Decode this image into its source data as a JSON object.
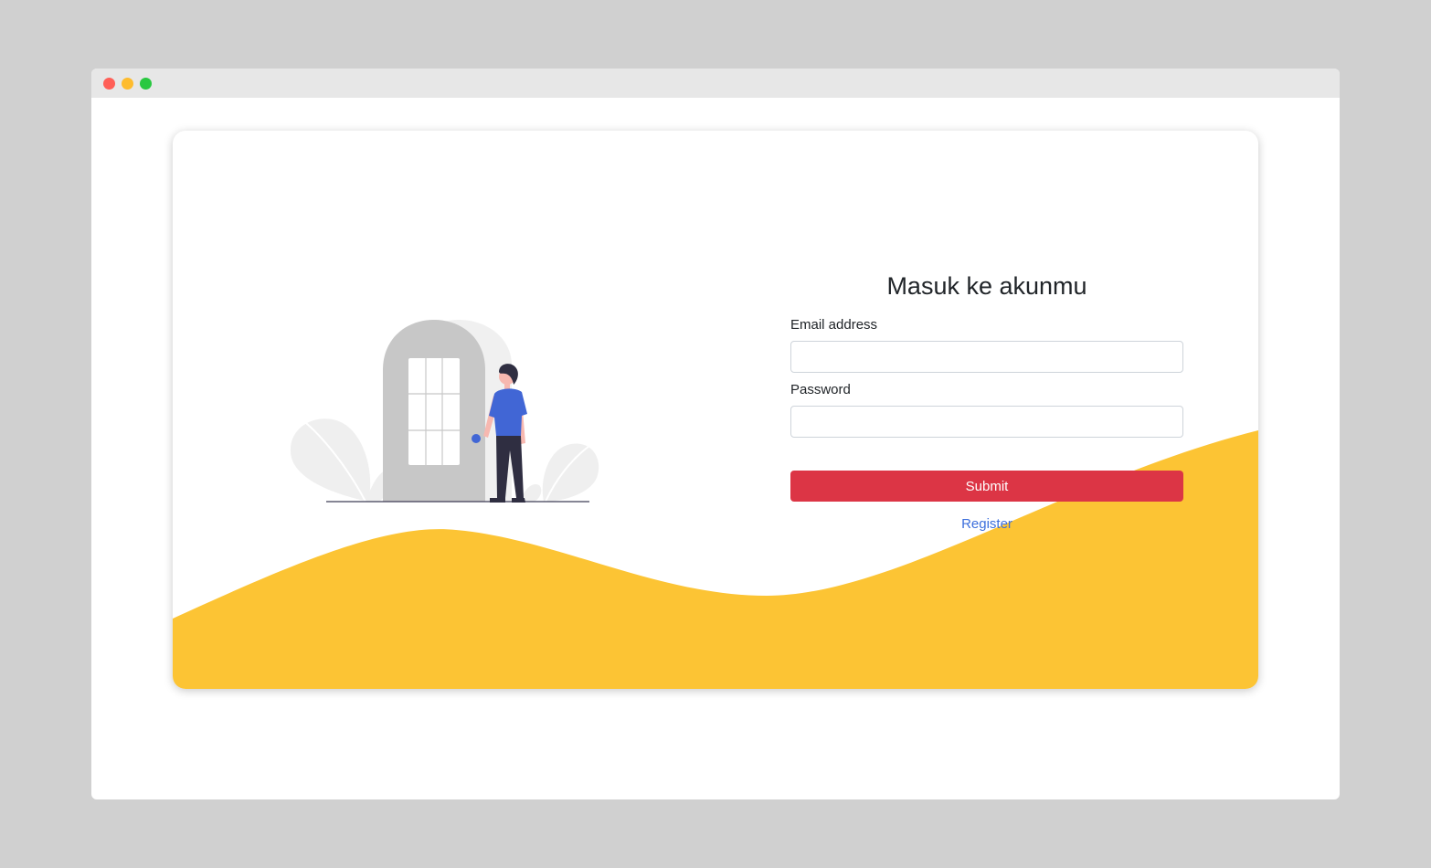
{
  "colors": {
    "page_background": "#d0d0d0",
    "titlebar": "#e7e7e7",
    "accent_wave": "#fcc434",
    "submit": "#dc3545",
    "link": "#3d6fdc",
    "figure_shirt": "#4166d5"
  },
  "window": {
    "controls": [
      "close",
      "minimize",
      "maximize"
    ]
  },
  "login": {
    "title": "Masuk ke akunmu",
    "email_label": "Email address",
    "email_value": "",
    "password_label": "Password",
    "password_value": "",
    "submit_label": "Submit",
    "register_label": "Register"
  },
  "illustration": {
    "icon": "person-entering-door-illustration"
  }
}
